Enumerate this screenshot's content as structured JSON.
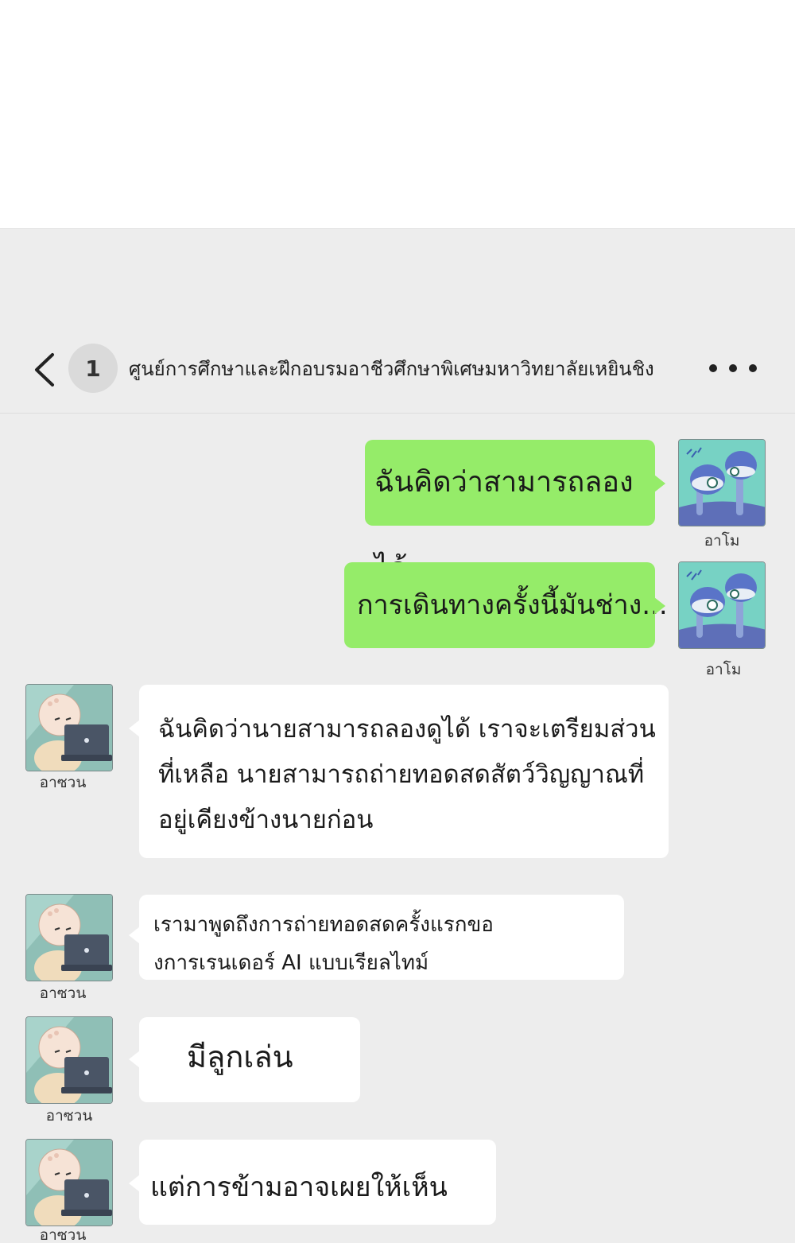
{
  "header": {
    "back_icon": "chevron-left-icon",
    "unread_count": "1",
    "title": "ศูนย์การศึกษาและฝึกอบรมอาชีวศึกษาพิเศษมหาวิทยาลัยเหยินชิง",
    "more_icon": "more-dots-icon"
  },
  "colors": {
    "chat_background": "#ededed",
    "outgoing_bubble": "#95ec69",
    "incoming_bubble": "#ffffff"
  },
  "messages": [
    {
      "direction": "outgoing",
      "sender": "อาโม",
      "text": "ฉันคิดว่าสามารถลองได้"
    },
    {
      "direction": "outgoing",
      "sender": "อาโม",
      "text": "การเดินทางครั้งนี้มันช่าง..."
    },
    {
      "direction": "incoming",
      "sender": "อาซวน",
      "text": "ฉันคิดว่านายสามารถลองดูได้ เราจะเตรียมส่วนที่เหลือ นายสามารถถ่ายทอดสดสัตว์วิญญาณที่อยู่เคียงข้างนายก่อน"
    },
    {
      "direction": "incoming",
      "sender": "อาซวน",
      "text": "เรามาพูดถึงการถ่ายทอดสดครั้งแรกของการเรนเดอร์ AI แบบเรียลไทม์"
    },
    {
      "direction": "incoming",
      "sender": "อาซวน",
      "text": "มีลูกเล่น"
    },
    {
      "direction": "incoming",
      "sender": "อาซวน",
      "text": "แต่การข้ามอาจเผยให้เห็น"
    }
  ]
}
